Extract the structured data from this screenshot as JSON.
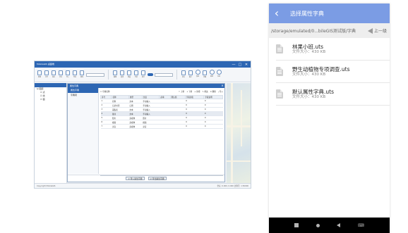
{
  "desktop": {
    "title": "MobileGIS 桌面端",
    "window_buttons": [
      "—",
      "□",
      "✕"
    ],
    "ribbon": {
      "group1": [
        "新建",
        "打开",
        "保存",
        "另存",
        "导入",
        "导出",
        "属性"
      ],
      "group2": [
        "编辑",
        "选择",
        "测量",
        "分析",
        "统计"
      ],
      "group3": [
        "放大",
        "缩小",
        "漫游",
        "全图",
        "刷新",
        "书签"
      ]
    },
    "tree": {
      "items": [
        {
          "label": "⊟ 图层",
          "level": 1
        },
        {
          "label": "☑ 点",
          "level": 2
        },
        {
          "label": "☑ 线",
          "level": 2
        },
        {
          "label": "☑ 面",
          "level": 2
        }
      ]
    },
    "dialog": {
      "title": "属性字典",
      "close": "✕",
      "side_items": [
        "属性字典",
        "字典项"
      ],
      "selected_side": 0,
      "toolbar_left": "☐ 字典名称",
      "toolbar_right": [
        "↑ 上移",
        "↓ 下移",
        "+ 新增",
        "✎ 修改",
        "✕ 删除",
        "⤓ 导入"
      ],
      "columns": [
        "序号",
        "名称",
        "类型",
        "长度",
        "必填",
        "默认值",
        "字段别名",
        "字段说明"
      ],
      "rows": [
        [
          "1",
          "名称",
          "文本",
          "手动输入",
          "",
          "",
          "0",
          "0"
        ],
        [
          "2",
          "记录时间",
          "日期",
          "手动输入",
          "",
          "",
          "0",
          "0"
        ],
        [
          "3",
          "采集者",
          "文本",
          "手动输入",
          "",
          "",
          "0",
          "0"
        ],
        [
          "4",
          "备注",
          "文本",
          "手动输入",
          "",
          "",
          "0",
          "0"
        ],
        [
          "5",
          "照片",
          "多媒体",
          "照片",
          "",
          "",
          "0",
          "0"
        ],
        [
          "6",
          "视频",
          "多媒体",
          "视频",
          "",
          "",
          "0",
          "0"
        ],
        [
          "7",
          "录音",
          "多媒体",
          "录音",
          "",
          "",
          "0",
          "0"
        ]
      ],
      "selected_row": 3,
      "footer_buttons": [
        "☑ 导入属性字典",
        "☑ 导出属性字典"
      ]
    },
    "status": {
      "left": "Copyright MobileGIS",
      "right": "坐标: 0.000, 0.000  比例尺: 1:50000"
    }
  },
  "phone": {
    "title": "选择属性字典",
    "back_icon": "‹",
    "path": "/storage/emulated/0...bileGIS测试版/字典",
    "up_label": "上一级",
    "files": [
      {
        "name": "林果小班.uts",
        "size": "文件大小：430 KB"
      },
      {
        "name": "野生动植物专项调查.uts",
        "size": "文件大小：430 KB"
      },
      {
        "name": "默认属性字典.uts",
        "size": "文件大小：430 KB"
      }
    ],
    "nav_keyboard": "⌨"
  },
  "colors": {
    "phone_accent": "#7b9ce4",
    "desktop_accent": "#2d66b3"
  }
}
